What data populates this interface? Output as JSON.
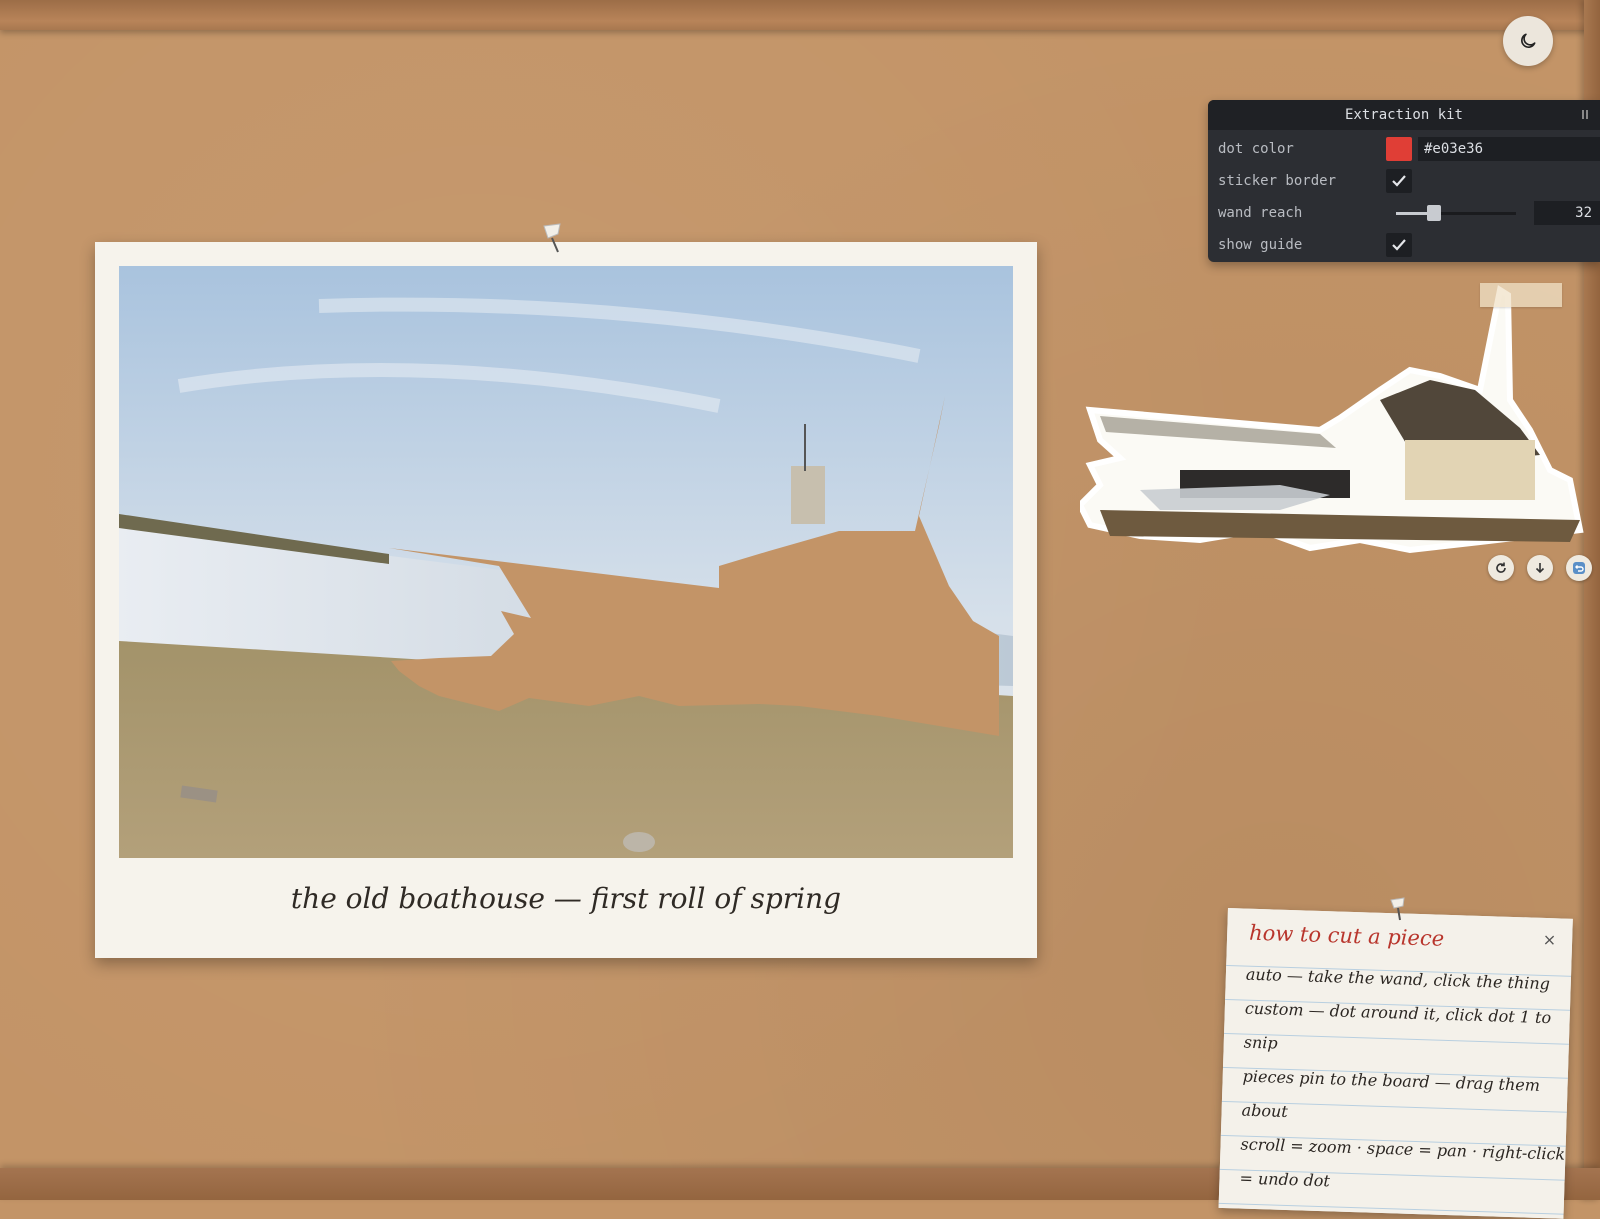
{
  "theme_toggle": {
    "icon": "moon-icon"
  },
  "kit": {
    "title": "Extraction kit",
    "rows": {
      "dot_color": {
        "label": "dot color",
        "value": "#e03e36"
      },
      "sticker_border": {
        "label": "sticker border",
        "checked": true
      },
      "wand_reach": {
        "label": "wand reach",
        "value": "32",
        "fraction": 0.32
      },
      "show_guide": {
        "label": "show guide",
        "checked": true
      }
    }
  },
  "photo": {
    "caption": "the old boathouse — first roll of spring"
  },
  "sticker_tools": {
    "rotate": {
      "icon": "rotate-icon"
    },
    "download": {
      "icon": "download-icon"
    },
    "return": {
      "icon": "return-icon"
    }
  },
  "note": {
    "title": "how to cut a piece",
    "close": "×",
    "lines": [
      "auto — take the wand, click the thing",
      "custom — dot around it, click dot 1 to",
      "snip",
      "pieces pin to the board — drag them",
      "about",
      "scroll = zoom · space = pan · right-click",
      "= undo dot"
    ]
  },
  "colors": {
    "board": "#c39467",
    "accent_red": "#e03e36",
    "panel": "#2c2e33"
  }
}
